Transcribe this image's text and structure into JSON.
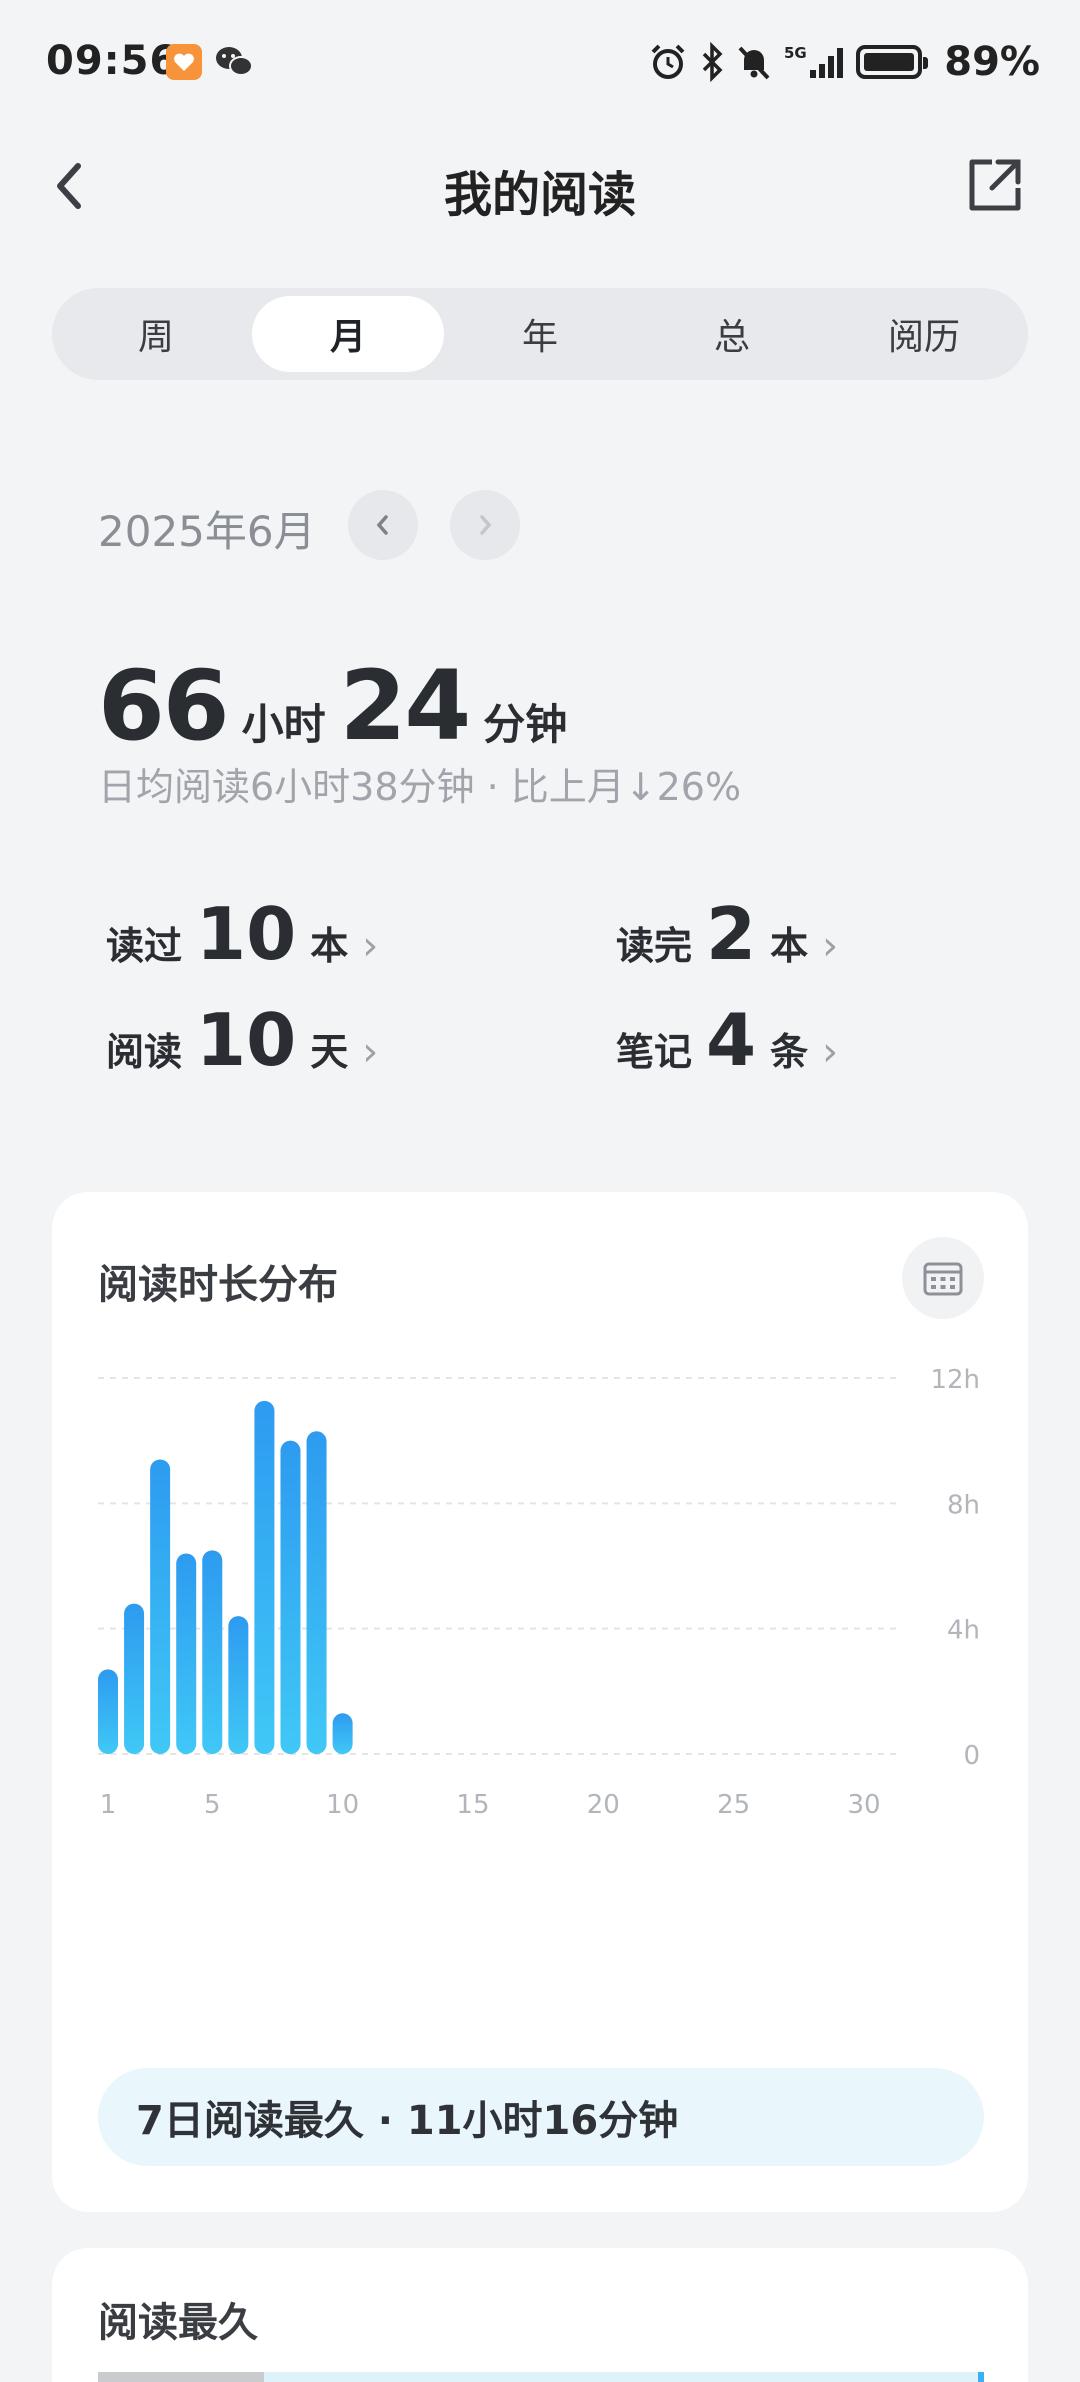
{
  "status_bar": {
    "time": "09:56",
    "network": "5G",
    "battery_percent": "89%",
    "battery_level": 0.89
  },
  "header": {
    "title": "我的阅读",
    "back_icon": "chevron-left-icon",
    "share_icon": "share-external-icon"
  },
  "tabs": [
    {
      "label": "周",
      "active": false
    },
    {
      "label": "月",
      "active": true
    },
    {
      "label": "年",
      "active": false
    },
    {
      "label": "总",
      "active": false
    },
    {
      "label": "阅历",
      "active": false
    }
  ],
  "period": {
    "label": "2025年6月"
  },
  "summary": {
    "hours": "66",
    "hours_unit": "小时",
    "minutes": "24",
    "minutes_unit": "分钟",
    "subline": "日均阅读6小时38分钟 · 比上月↓26%"
  },
  "stats": {
    "read": {
      "label": "读过",
      "value": "10",
      "unit": "本"
    },
    "finished": {
      "label": "读完",
      "value": "2",
      "unit": "本"
    },
    "days": {
      "label": "阅读",
      "value": "10",
      "unit": "天"
    },
    "notes": {
      "label": "笔记",
      "value": "4",
      "unit": "条"
    }
  },
  "chart_card": {
    "title": "阅读时长分布",
    "calendar_icon": "calendar-icon",
    "highlight": "7日阅读最久 · 11小时16分钟"
  },
  "chart_data": {
    "type": "bar",
    "title": "阅读时长分布",
    "x": [
      1,
      2,
      3,
      4,
      5,
      6,
      7,
      8,
      9,
      10
    ],
    "values": [
      2.7,
      4.8,
      9.4,
      6.4,
      6.5,
      4.4,
      11.27,
      10.0,
      10.3,
      1.3
    ],
    "x_ticks": [
      "1",
      "5",
      "10",
      "15",
      "20",
      "25",
      "30"
    ],
    "x_range": [
      1,
      30
    ],
    "y_ticks": [
      "0",
      "4h",
      "8h",
      "12h"
    ],
    "ylim": [
      0,
      12
    ],
    "grid": true,
    "colors": {
      "bar_top": "#2d9bf0",
      "bar_bottom": "#40c8f6"
    }
  },
  "card2": {
    "title": "阅读最久"
  }
}
